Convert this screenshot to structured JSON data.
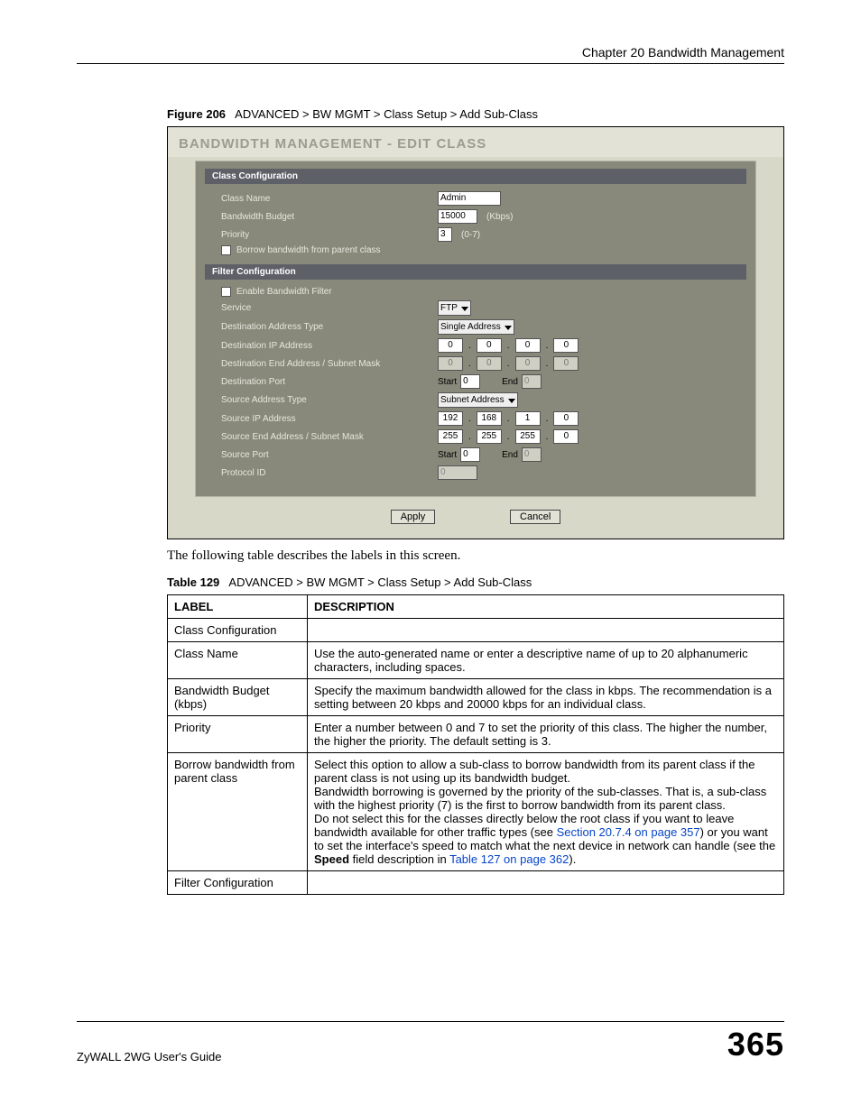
{
  "header": {
    "chapter": "Chapter 20 Bandwidth Management"
  },
  "figure_caption": {
    "prefix": "Figure 206",
    "text": "ADVANCED > BW MGMT > Class Setup > Add Sub-Class"
  },
  "panel": {
    "title": "BANDWIDTH MANAGEMENT - EDIT CLASS",
    "sections": {
      "class_config": {
        "bar": "Class Configuration",
        "class_name_label": "Class Name",
        "class_name_value": "Admin",
        "bandwidth_budget_label": "Bandwidth Budget",
        "bandwidth_budget_value": "15000",
        "bandwidth_budget_unit": "(Kbps)",
        "priority_label": "Priority",
        "priority_value": "3",
        "priority_unit": "(0-7)",
        "borrow_label": "Borrow bandwidth from parent class"
      },
      "filter_config": {
        "bar": "Filter Configuration",
        "enable_label": "Enable Bandwidth Filter",
        "service_label": "Service",
        "service_value": "FTP",
        "dest_addr_type_label": "Destination Address Type",
        "dest_addr_type_value": "Single Address",
        "dest_ip_label": "Destination IP Address",
        "dest_ip": [
          "0",
          "0",
          "0",
          "0"
        ],
        "dest_end_label": "Destination End Address / Subnet Mask",
        "dest_end": [
          "0",
          "0",
          "0",
          "0"
        ],
        "dest_port_label": "Destination Port",
        "dest_port_start_label": "Start",
        "dest_port_start": "0",
        "dest_port_end_label": "End",
        "dest_port_end": "0",
        "src_addr_type_label": "Source Address Type",
        "src_addr_type_value": "Subnet Address",
        "src_ip_label": "Source IP Address",
        "src_ip": [
          "192",
          "168",
          "1",
          "0"
        ],
        "src_end_label": "Source End Address / Subnet Mask",
        "src_end": [
          "255",
          "255",
          "255",
          "0"
        ],
        "src_port_label": "Source Port",
        "src_port_start_label": "Start",
        "src_port_start": "0",
        "src_port_end_label": "End",
        "src_port_end": "0",
        "protocol_label": "Protocol ID",
        "protocol_value": "0"
      }
    },
    "buttons": {
      "apply": "Apply",
      "cancel": "Cancel"
    }
  },
  "body_text": "The following table describes the labels in this screen.",
  "table_caption": {
    "prefix": "Table 129",
    "text": "ADVANCED > BW MGMT > Class Setup > Add Sub-Class"
  },
  "table": {
    "headers": {
      "label": "LABEL",
      "description": "DESCRIPTION"
    },
    "rows": {
      "r0": {
        "label": "Class Configuration",
        "desc": ""
      },
      "r1": {
        "label": "Class Name",
        "desc": "Use the auto-generated name or enter a descriptive name of up to 20 alphanumeric characters, including spaces."
      },
      "r2": {
        "label": "Bandwidth Budget (kbps)",
        "desc": "Specify the maximum bandwidth allowed for the class in kbps. The recommendation is a setting between 20 kbps and 20000 kbps for an individual class."
      },
      "r3": {
        "label": "Priority",
        "desc": "Enter a number between 0 and 7 to set the priority of this class. The higher the number, the higher the priority. The default setting is 3."
      },
      "r4": {
        "label": "Borrow bandwidth from parent class",
        "p1": "Select this option to allow a sub-class to borrow bandwidth from its parent class if the parent class is not using up its bandwidth budget.",
        "p2": "Bandwidth borrowing is governed by the priority of the sub-classes. That is, a sub-class with the highest priority (7) is the first to borrow bandwidth from its parent class.",
        "p3a": "Do not select this for the classes directly below the root class if you want to leave bandwidth available for other traffic types (see ",
        "p3link1": "Section 20.7.4 on page 357",
        "p3b": ") or you want to set the interface's speed to match what the next device in network can handle (see the ",
        "p3bold": "Speed",
        "p3c": " field description in ",
        "p3link2": "Table 127 on page 362",
        "p3d": ")."
      },
      "r5": {
        "label": "Filter Configuration",
        "desc": ""
      }
    }
  },
  "footer": {
    "guide": "ZyWALL 2WG User's Guide",
    "page": "365"
  }
}
